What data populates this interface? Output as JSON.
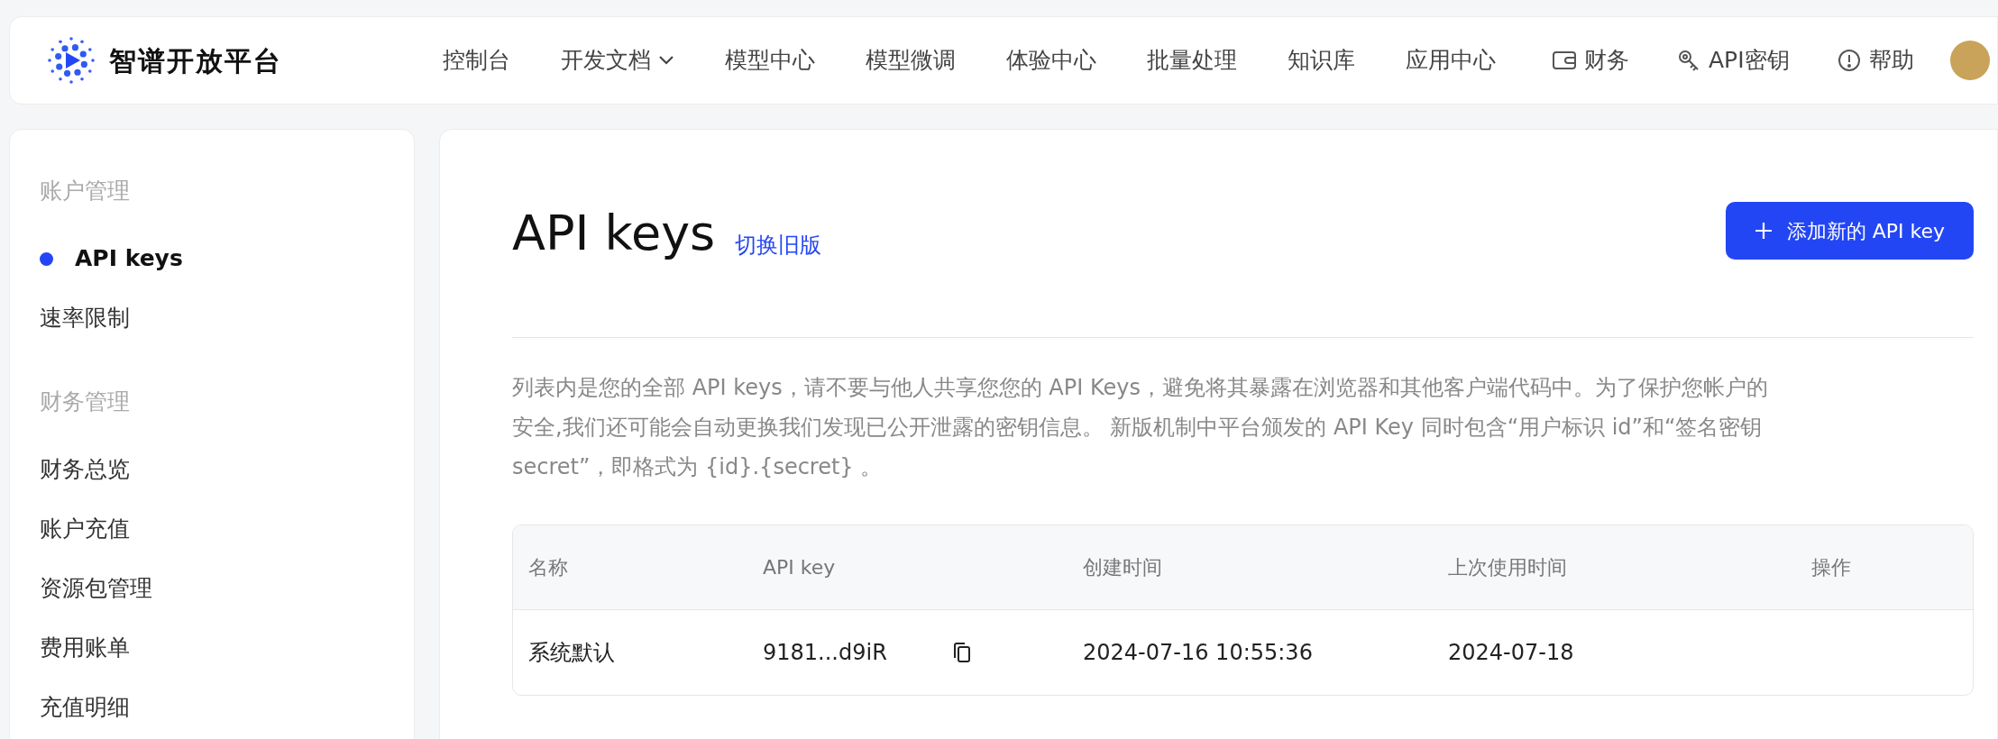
{
  "header": {
    "brand": "智谱开放平台",
    "nav": [
      {
        "label": "控制台",
        "dropdown": false
      },
      {
        "label": "开发文档",
        "dropdown": true
      },
      {
        "label": "模型中心",
        "dropdown": false
      },
      {
        "label": "模型微调",
        "dropdown": false
      },
      {
        "label": "体验中心",
        "dropdown": false
      },
      {
        "label": "批量处理",
        "dropdown": false
      },
      {
        "label": "知识库",
        "dropdown": false
      },
      {
        "label": "应用中心",
        "dropdown": false
      }
    ],
    "actions": [
      {
        "kind": "wallet",
        "label": "财务"
      },
      {
        "kind": "key",
        "label": "API密钥"
      },
      {
        "kind": "help",
        "label": "帮助"
      }
    ]
  },
  "sidebar": {
    "sections": [
      {
        "label": "账户管理",
        "items": [
          {
            "label": "API keys",
            "selected": true
          },
          {
            "label": "速率限制",
            "selected": false
          }
        ]
      },
      {
        "label": "财务管理",
        "items": [
          {
            "label": "财务总览",
            "selected": false
          },
          {
            "label": "账户充值",
            "selected": false
          },
          {
            "label": "资源包管理",
            "selected": false
          },
          {
            "label": "费用账单",
            "selected": false
          },
          {
            "label": "充值明细",
            "selected": false
          }
        ]
      }
    ]
  },
  "main": {
    "title": "API keys",
    "switch_link": "切换旧版",
    "add_button": "添加新的 API key",
    "description": "列表内是您的全部 API keys，请不要与他人共享您您的 API Keys，避免将其暴露在浏览器和其他客户端代码中。为了保护您帐户的安全,我们还可能会自动更换我们发现已公开泄露的密钥信息。 新版机制中平台颁发的 API Key 同时包含“用户标识 id”和“签名密钥 secret”，即格式为 {id}.{secret} 。",
    "table": {
      "columns": [
        "名称",
        "API key",
        "创建时间",
        "上次使用时间",
        "操作"
      ],
      "rows": [
        {
          "name": "系统默认",
          "key": "9181...d9iR",
          "created": "2024-07-16 10:55:36",
          "last_used": "2024-07-18"
        }
      ]
    }
  }
}
